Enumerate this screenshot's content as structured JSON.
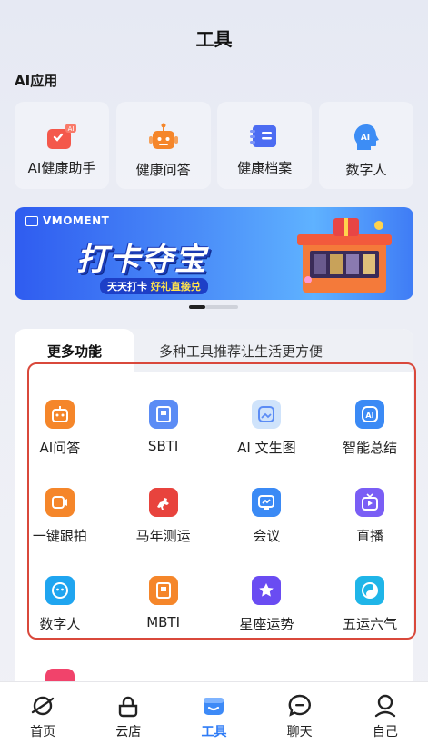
{
  "header": {
    "title": "工具"
  },
  "ai_apps": {
    "section_title": "AI应用",
    "items": [
      {
        "label": "AI健康助手",
        "icon": "ai-health-assistant-icon",
        "color": "#f4584b"
      },
      {
        "label": "健康问答",
        "icon": "robot-icon",
        "color": "#f5862a"
      },
      {
        "label": "健康档案",
        "icon": "health-record-icon",
        "color": "#4c6cf2"
      },
      {
        "label": "数字人",
        "icon": "ai-head-icon",
        "color": "#3d8df5"
      }
    ]
  },
  "banner": {
    "brand": "VMOMENT",
    "headline": "打卡夺宝",
    "tagline_a": "天天打卡 ",
    "tagline_b": "好礼直接兑"
  },
  "more_features": {
    "tab_label": "更多功能",
    "hint": "多种工具推荐让生活更方便",
    "tools": [
      {
        "label": "AI问答",
        "icon": "robot-icon",
        "color": "#f5862a"
      },
      {
        "label": "SBTI",
        "icon": "book-icon",
        "color": "#5b8cf5"
      },
      {
        "label": "AI 文生图",
        "icon": "image-icon",
        "color": "#7fb6f7"
      },
      {
        "label": "智能总结",
        "icon": "ai-summary-icon",
        "color": "#3b8af5"
      },
      {
        "label": "一键跟拍",
        "icon": "video-camera-icon",
        "color": "#f5862a"
      },
      {
        "label": "马年测运",
        "icon": "horse-icon",
        "color": "#e8433d"
      },
      {
        "label": "会议",
        "icon": "meeting-icon",
        "color": "#3b8af5"
      },
      {
        "label": "直播",
        "icon": "live-tv-icon",
        "color": "#7a5ef5"
      },
      {
        "label": "数字人",
        "icon": "smiley-icon",
        "color": "#1fa5f0"
      },
      {
        "label": "MBTI",
        "icon": "book-icon",
        "color": "#f5862a"
      },
      {
        "label": "星座运势",
        "icon": "star-icon",
        "color": "#6a4cf2"
      },
      {
        "label": "五运六气",
        "icon": "yin-yang-icon",
        "color": "#1fb5e8"
      }
    ]
  },
  "bottom_nav": {
    "items": [
      {
        "label": "首页",
        "icon": "planet-icon",
        "active": false
      },
      {
        "label": "云店",
        "icon": "bag-icon",
        "active": false
      },
      {
        "label": "工具",
        "icon": "toolbox-icon",
        "active": true
      },
      {
        "label": "聊天",
        "icon": "chat-bubble-icon",
        "active": false
      },
      {
        "label": "自己",
        "icon": "person-icon",
        "active": false
      }
    ]
  }
}
